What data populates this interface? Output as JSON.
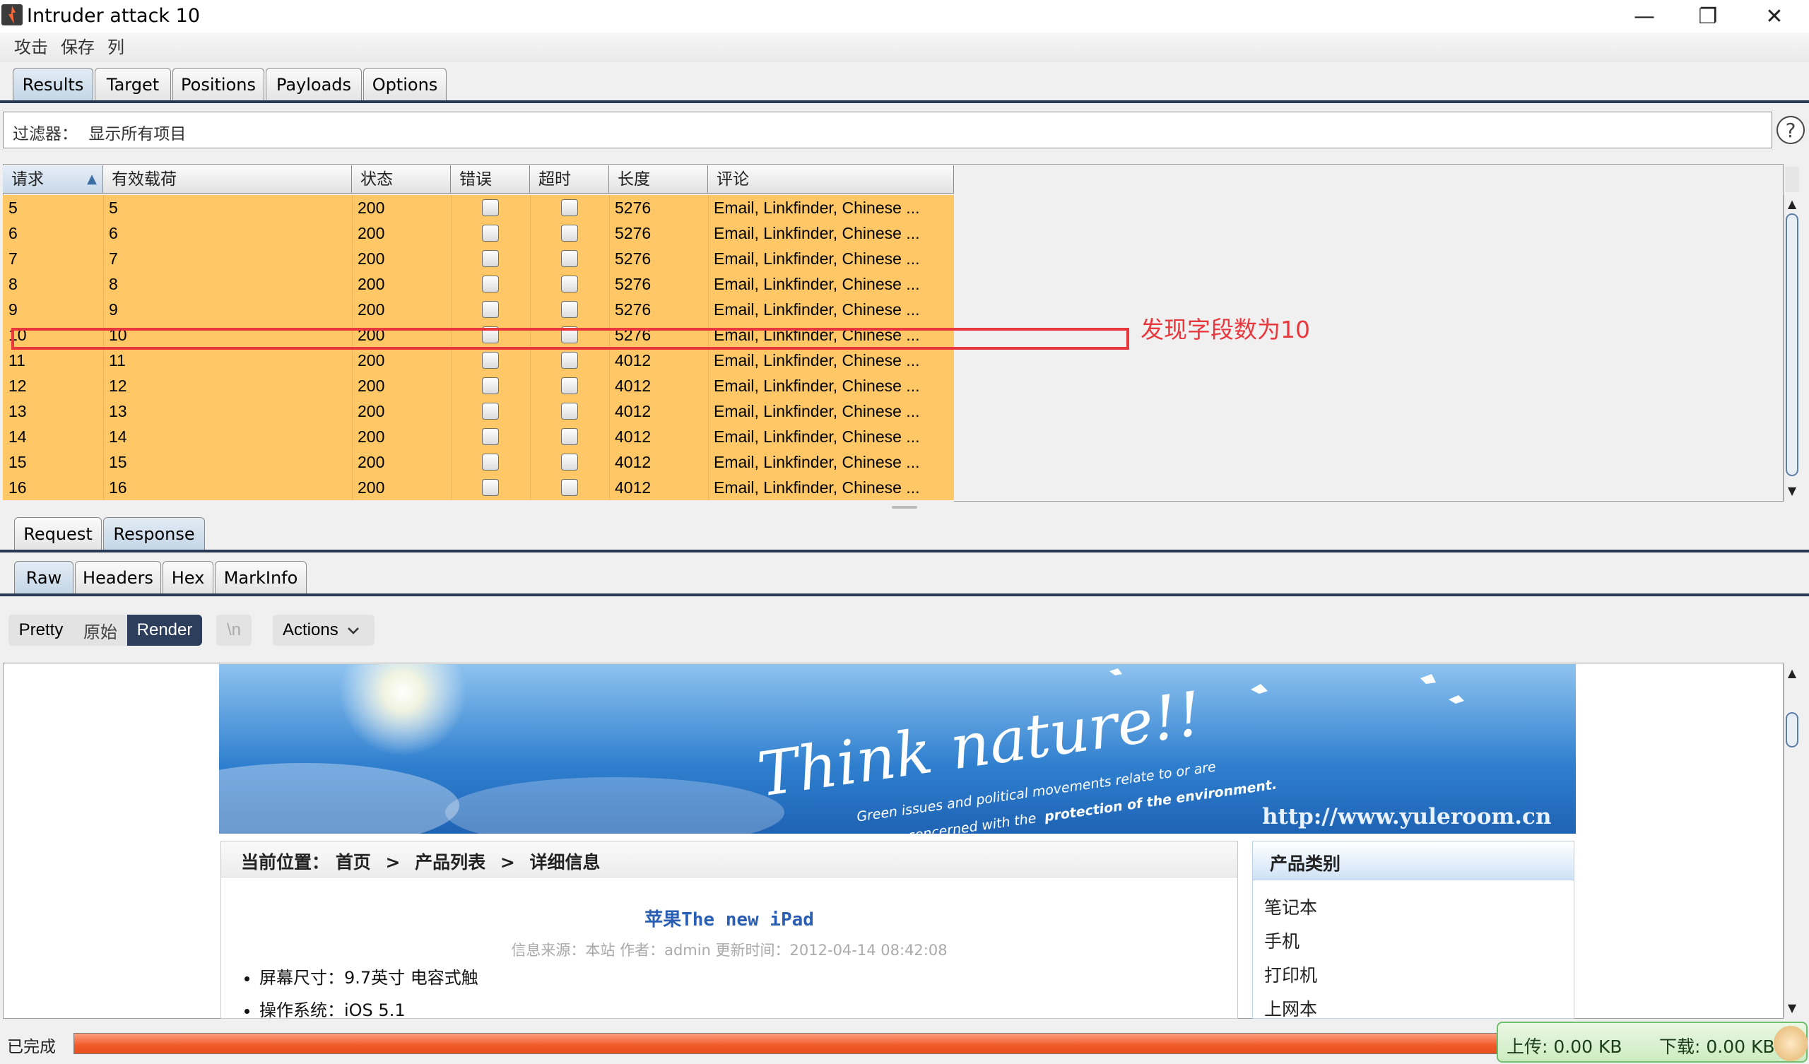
{
  "window": {
    "title": "Intruder attack 10",
    "minimize_glyph": "—",
    "maximize_glyph": "❐",
    "close_glyph": "✕"
  },
  "menu": [
    "攻击",
    "保存",
    "列"
  ],
  "main_tabs": [
    {
      "label": "Results",
      "active": true
    },
    {
      "label": "Target",
      "active": false
    },
    {
      "label": "Positions",
      "active": false
    },
    {
      "label": "Payloads",
      "active": false
    },
    {
      "label": "Options",
      "active": false
    }
  ],
  "filter": {
    "label": "过滤器：",
    "value": "显示所有项目",
    "help_glyph": "?"
  },
  "table": {
    "columns": [
      "请求",
      "有效载荷",
      "状态",
      "错误",
      "超时",
      "长度",
      "评论"
    ],
    "sort_glyph": "▲",
    "rows": [
      {
        "request": "5",
        "payload": "5",
        "status": "200",
        "error": false,
        "timeout": false,
        "length": "5276",
        "comment": "Email, Linkfinder, Chinese ..."
      },
      {
        "request": "6",
        "payload": "6",
        "status": "200",
        "error": false,
        "timeout": false,
        "length": "5276",
        "comment": "Email, Linkfinder, Chinese ..."
      },
      {
        "request": "7",
        "payload": "7",
        "status": "200",
        "error": false,
        "timeout": false,
        "length": "5276",
        "comment": "Email, Linkfinder, Chinese ..."
      },
      {
        "request": "8",
        "payload": "8",
        "status": "200",
        "error": false,
        "timeout": false,
        "length": "5276",
        "comment": "Email, Linkfinder, Chinese ..."
      },
      {
        "request": "9",
        "payload": "9",
        "status": "200",
        "error": false,
        "timeout": false,
        "length": "5276",
        "comment": "Email, Linkfinder, Chinese ..."
      },
      {
        "request": "10",
        "payload": "10",
        "status": "200",
        "error": false,
        "timeout": false,
        "length": "5276",
        "comment": "Email, Linkfinder, Chinese ..."
      },
      {
        "request": "11",
        "payload": "11",
        "status": "200",
        "error": false,
        "timeout": false,
        "length": "4012",
        "comment": "Email, Linkfinder, Chinese ..."
      },
      {
        "request": "12",
        "payload": "12",
        "status": "200",
        "error": false,
        "timeout": false,
        "length": "4012",
        "comment": "Email, Linkfinder, Chinese ..."
      },
      {
        "request": "13",
        "payload": "13",
        "status": "200",
        "error": false,
        "timeout": false,
        "length": "4012",
        "comment": "Email, Linkfinder, Chinese ..."
      },
      {
        "request": "14",
        "payload": "14",
        "status": "200",
        "error": false,
        "timeout": false,
        "length": "4012",
        "comment": "Email, Linkfinder, Chinese ..."
      },
      {
        "request": "15",
        "payload": "15",
        "status": "200",
        "error": false,
        "timeout": false,
        "length": "4012",
        "comment": "Email, Linkfinder, Chinese ..."
      },
      {
        "request": "16",
        "payload": "16",
        "status": "200",
        "error": false,
        "timeout": false,
        "length": "4012",
        "comment": "Email, Linkfinder, Chinese ..."
      }
    ],
    "row_color": "#ffc765"
  },
  "annotation": {
    "text": "发现字段数为10",
    "color": "#e8383d"
  },
  "message_tabs": [
    {
      "label": "Request",
      "active": false
    },
    {
      "label": "Response",
      "active": true
    }
  ],
  "view_tabs": [
    {
      "label": "Raw",
      "active": true
    },
    {
      "label": "Headers",
      "active": false
    },
    {
      "label": "Hex",
      "active": false
    },
    {
      "label": "MarkInfo",
      "active": false
    }
  ],
  "render_toolbar": {
    "pretty": "Pretty",
    "raw": "原始",
    "render": "Render",
    "newline": "\\n",
    "actions": "Actions"
  },
  "page": {
    "banner": {
      "headline": "Think nature!!",
      "tagline_1": "Green issues and political movements relate to or are",
      "tagline_2": "concerned with the",
      "tagline_bold": "protection of the environment.",
      "url": "http://www.yuleroom.cn"
    },
    "breadcrumb": {
      "prefix": "当前位置：",
      "items": [
        "首页",
        "产品列表",
        "详细信息"
      ],
      "sep": ">"
    },
    "product_title": "苹果The new iPad",
    "meta": "信息来源：本站  作者：admin 更新时间：2012-04-14 08:42:08",
    "specs": [
      "屏幕尺寸：9.7英寸  电容式触",
      "操作系统：iOS 5.1"
    ],
    "sidebar": {
      "title": "产品类别",
      "items": [
        "笔记本",
        "手机",
        "打印机",
        "上网本"
      ]
    }
  },
  "status": {
    "text": "已完成",
    "progress_percent": 100,
    "upload": "上传: 0.00 KB",
    "download": "下载: 0.00 KB"
  }
}
